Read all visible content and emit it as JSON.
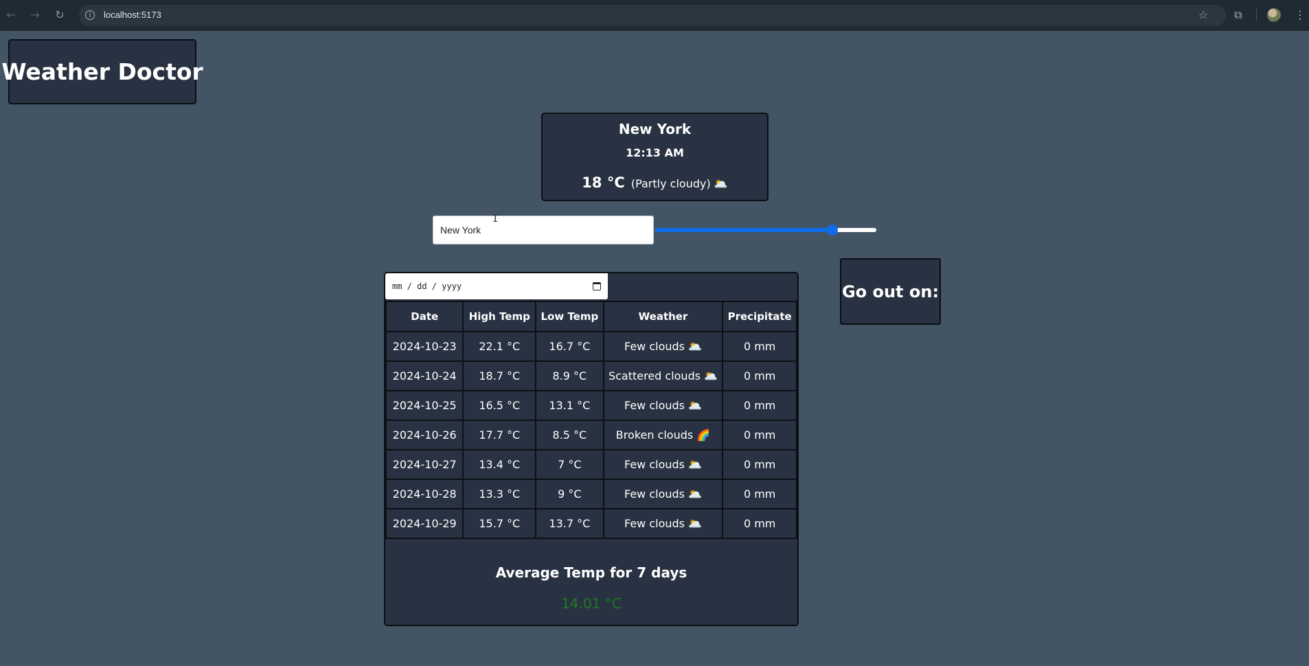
{
  "browser": {
    "url": "localhost:5173",
    "icons": [
      "back-icon",
      "forward-icon",
      "reload-icon",
      "site-info-icon",
      "bookmark-star-icon",
      "extensions-icon",
      "profile-avatar-icon",
      "menu-dots-icon"
    ]
  },
  "app": {
    "title": "Weather Doctor"
  },
  "current": {
    "city": "New York",
    "time": "12:13 AM",
    "temp": "18 °C",
    "condition": "(Partly cloudy) 🌥️"
  },
  "search": {
    "value": "New York"
  },
  "slider": {
    "level_fraction": 0.8,
    "accent": "#0f6be8"
  },
  "date_picker": {
    "placeholder": "mm / dd / yyyy"
  },
  "go_out": {
    "label": "Go out on:"
  },
  "forecast": {
    "headers": [
      "Date",
      "High Temp",
      "Low Temp",
      "Weather",
      "Precipitate"
    ],
    "rows": [
      [
        "2024-10-23",
        "22.1 °C",
        "16.7 °C",
        "Few clouds 🌥️",
        "0 mm"
      ],
      [
        "2024-10-24",
        "18.7 °C",
        "8.9 °C",
        "Scattered clouds 🌥️",
        "0 mm"
      ],
      [
        "2024-10-25",
        "16.5 °C",
        "13.1 °C",
        "Few clouds 🌥️",
        "0 mm"
      ],
      [
        "2024-10-26",
        "17.7 °C",
        "8.5 °C",
        "Broken clouds 🌈",
        "0 mm"
      ],
      [
        "2024-10-27",
        "13.4 °C",
        "7 °C",
        "Few clouds 🌥️",
        "0 mm"
      ],
      [
        "2024-10-28",
        "13.3 °C",
        "9 °C",
        "Few clouds 🌥️",
        "0 mm"
      ],
      [
        "2024-10-29",
        "15.7 °C",
        "13.7 °C",
        "Few clouds 🌥️",
        "0 mm"
      ]
    ],
    "average_title": "Average Temp for 7 days",
    "average_value": "14.01 °C",
    "average_color": "#1f7a1f"
  }
}
